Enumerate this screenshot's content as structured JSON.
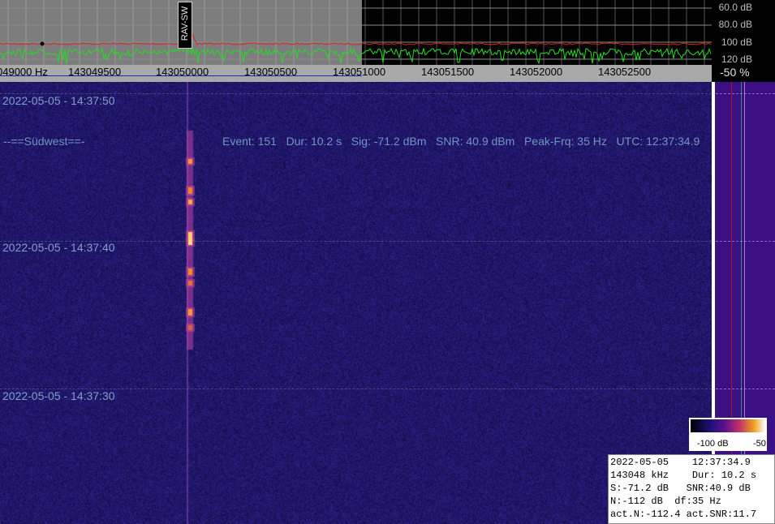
{
  "spectrum": {
    "db_labels": [
      "60.0 dB",
      "80.0 dB",
      "100 dB",
      "120 dB"
    ],
    "marker_label": "RAV-SW",
    "noise_color": "#22e022",
    "peak_color": "#e02020"
  },
  "freq_axis": {
    "ticks": [
      "049000 Hz",
      "143049500",
      "143050000",
      "143050500",
      "143051000",
      "143051500",
      "143052000",
      "143052500"
    ]
  },
  "level": {
    "label": "-50 %"
  },
  "waterfall": {
    "timestamps": [
      "2022-05-05 - 14:37:50",
      "2022-05-05 - 14:37:40",
      "2022-05-05 - 14:37:30"
    ],
    "station": "--==Südwest==-",
    "event_line": "Event: 151   Dur: 10.2 s   Sig: -71.2 dBm   SNR: 40.9 dBm   Peak-Frq: 35 Hz   UTC: 12:37:34.9"
  },
  "colorbar": {
    "min_label": "-100 dB",
    "max_label": "-50"
  },
  "info": {
    "line1": "2022-05-05    12:37:34.9",
    "line2": "143048 kHz    Dur: 10.2 s",
    "line3": "S:-71.2 dB   SNR:40.9 dB",
    "line4": "N:-112 dB  df:35 Hz",
    "line5": "act.N:-112.4 act.SNR:11.7"
  }
}
